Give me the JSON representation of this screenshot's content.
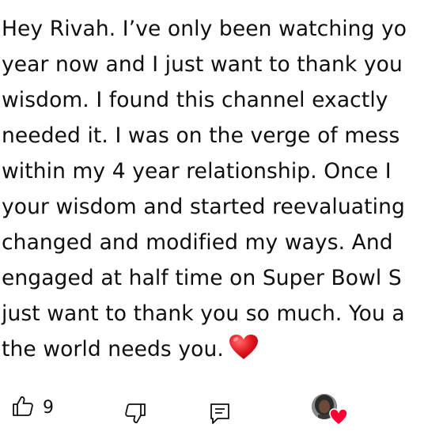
{
  "comment": {
    "lines": [
      "Hey Rivah. I’ve only been watching yo",
      "year now and I just want to thank you",
      "wisdom. I found this channel exactly",
      "needed it. I was on the verge of mess",
      "within my 4 year relationship. Once I",
      "your wisdom and started reevaluating",
      "changed and modified my ways. And",
      "engaged at half time on Super Bowl S",
      "just want to thank you so much. You a",
      "the world needs you."
    ],
    "emoji": "red-heart"
  },
  "actions": {
    "like_count": "9",
    "like_icon": "thumbs-up-icon",
    "dislike_icon": "thumbs-down-icon",
    "reply_icon": "reply-comment-icon"
  },
  "creator_heart": {
    "badge_icon": "heart-icon",
    "badge_color": "#ff0033"
  },
  "colors": {
    "text": "#0f0f0f",
    "background": "#ffffff",
    "heart": "#e11d2a"
  }
}
